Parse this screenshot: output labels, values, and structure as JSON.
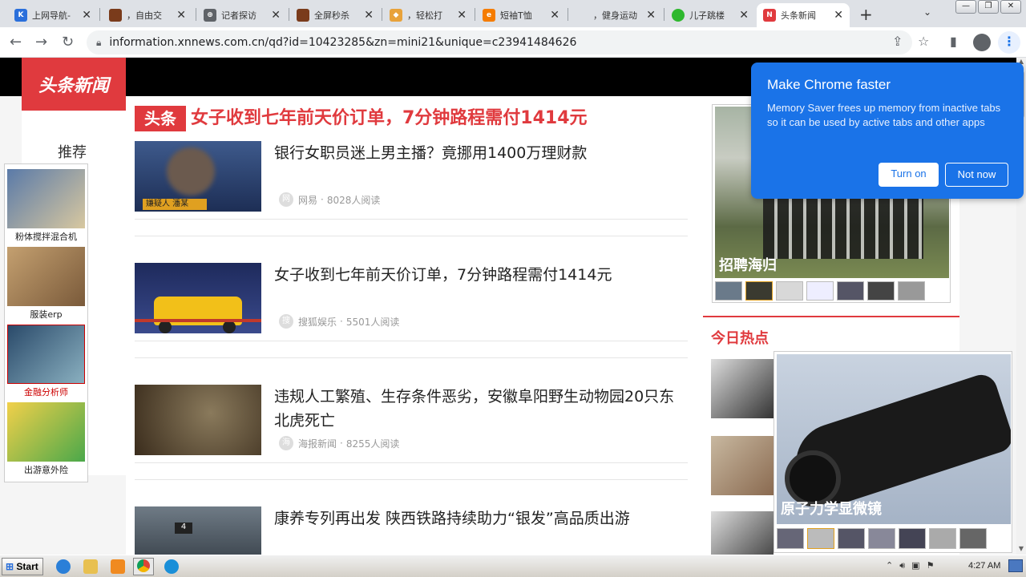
{
  "browser": {
    "tabs": [
      {
        "title": "上网导航-",
        "color": "#2a6fdb",
        "glyph": "K"
      },
      {
        "title": "，自由交",
        "color": "#7a3b1b",
        "glyph": ""
      },
      {
        "title": "记者探访",
        "color": "#5f6368",
        "glyph": "⊕"
      },
      {
        "title": "全屏秒杀",
        "color": "#7a3b1b",
        "glyph": ""
      },
      {
        "title": "，轻松打",
        "color": "#e8a23a",
        "glyph": "◆"
      },
      {
        "title": "短袖T恤",
        "color": "#f57c00",
        "glyph": "e"
      },
      {
        "title": "，健身运动",
        "color": "#ffffff",
        "glyph": ""
      },
      {
        "title": "儿子跳楼",
        "color": "#2eb82e",
        "glyph": "○"
      },
      {
        "title": "头条新闻",
        "color": "#e03a3e",
        "glyph": "N"
      }
    ],
    "active_tab_index": 8,
    "new_tab": "+",
    "url": "information.xnnews.com.cn/qd?id=10423285&zn=mini21&unique=c23941484626"
  },
  "site": {
    "logo": "头条新闻",
    "nav_recommend": "推荐",
    "headline_tag": "头条",
    "headline": "女子收到七年前天价订单，7分钟路程需付1414元",
    "news": [
      {
        "title": "银行女职员迷上男主播？竟挪用1400万理财款",
        "source": "网易",
        "source_icon": "网",
        "reads": "8028人阅读",
        "thumb_caption": "嫌疑人 潘某"
      },
      {
        "title": "女子收到七年前天价订单，7分钟路程需付1414元",
        "source": "搜狐娱乐",
        "source_icon": "搜",
        "reads": "5501人阅读"
      },
      {
        "title": "违规人工繁殖、生存条件恶劣，安徽阜阳野生动物园20只东北虎死亡",
        "source": "海报新闻",
        "source_icon": "海",
        "reads": "8255人阅读"
      },
      {
        "title": "康养专列再出发 陕西铁路持续助力“银发”高品质出游",
        "source": "",
        "source_icon": "",
        "reads": "",
        "thumb_caption": "4"
      }
    ],
    "meta_sep": "·",
    "side_ads": [
      {
        "label": "粉体搅拌混合机"
      },
      {
        "label": "服装erp"
      },
      {
        "label": "金融分析师"
      },
      {
        "label": "出游意外险"
      }
    ],
    "recruit_ad_label": "招聘海归",
    "hot_title": "今日热点",
    "hot_ad_label": "原子力学显微镜"
  },
  "popup": {
    "title": "Make Chrome faster",
    "body": "Memory Saver frees up memory from inactive tabs so it can be used by active tabs and other apps",
    "turn_on": "Turn on",
    "not_now": "Not now"
  },
  "taskbar": {
    "start": "Start",
    "clock": "4:27 AM"
  },
  "colors": {
    "brand_red": "#e03a3e",
    "chrome_blue": "#1a73e8"
  }
}
